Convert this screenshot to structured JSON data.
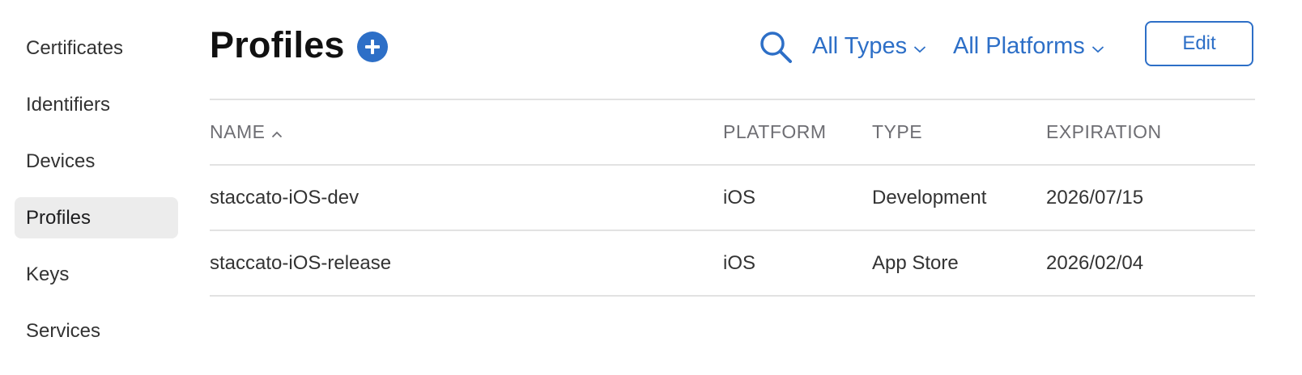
{
  "sidebar": {
    "items": [
      {
        "label": "Certificates"
      },
      {
        "label": "Identifiers"
      },
      {
        "label": "Devices"
      },
      {
        "label": "Profiles",
        "active": true
      },
      {
        "label": "Keys"
      },
      {
        "label": "Services"
      }
    ]
  },
  "header": {
    "title": "Profiles",
    "add_icon": "plus-circle-icon",
    "search_icon": "magnifier-icon",
    "filters": {
      "types_label": "All Types",
      "platforms_label": "All Platforms"
    },
    "edit_label": "Edit"
  },
  "table": {
    "columns": {
      "name": "NAME",
      "platform": "PLATFORM",
      "type": "TYPE",
      "expiration": "EXPIRATION"
    },
    "sort": {
      "column": "name",
      "direction": "ascending"
    },
    "rows": [
      {
        "name": "staccato-iOS-dev",
        "platform": "iOS",
        "type": "Development",
        "expiration": "2026/07/15"
      },
      {
        "name": "staccato-iOS-release",
        "platform": "iOS",
        "type": "App Store",
        "expiration": "2026/02/04"
      }
    ]
  },
  "colors": {
    "accent": "#2d6fc7",
    "active_item_bg": "#ececec",
    "divider": "#e2e2e2"
  }
}
